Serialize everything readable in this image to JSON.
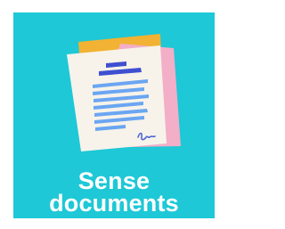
{
  "app_tile": {
    "label_line1": "Sense",
    "label_line2": "documents",
    "icon": "document-with-signature-icon",
    "colors": {
      "background": "#1ec8d6",
      "back_sheet_yellow": "#f2b233",
      "back_sheet_pink": "#f3aec8",
      "paper": "#f7f3ea",
      "heading_bar": "#3f4fd1",
      "text_lines": "#6aa6f2",
      "signature": "#4e67d8",
      "label_text": "#ffffff"
    }
  }
}
